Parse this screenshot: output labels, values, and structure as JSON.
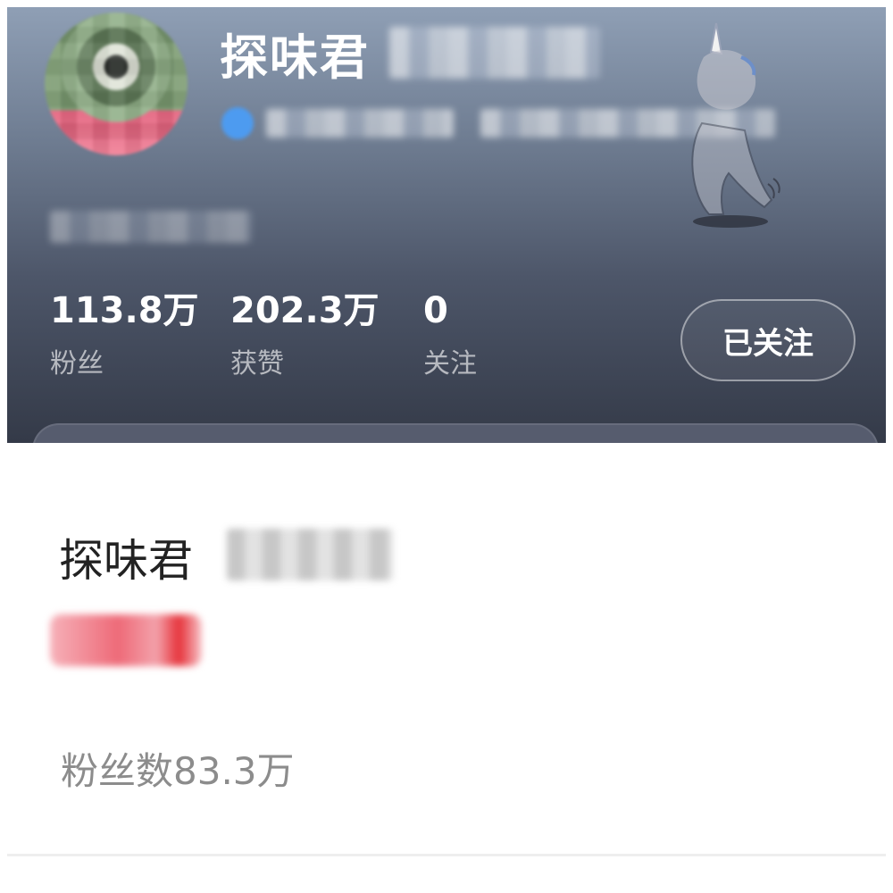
{
  "profile_header": {
    "name": "探味君",
    "stats": {
      "fans": {
        "value": "113.8万",
        "label": "粉丝"
      },
      "likes": {
        "value": "202.3万",
        "label": "获赞"
      },
      "following": {
        "value": "0",
        "label": "关注"
      }
    },
    "follow_button_label": "已关注",
    "icons": {
      "avatar": "avatar-image",
      "verification": "verified-badge-icon",
      "mascot": "unicorn-mascot-icon"
    },
    "colors": {
      "gradient_top": "#8f9fb5",
      "gradient_bottom": "#343a48",
      "verified_blue": "#4d9bf0"
    }
  },
  "account_card": {
    "name": "探味君",
    "fans_count": "粉丝数83.3万",
    "colors": {
      "tag_red": "#e6323a",
      "text_dark": "#222222",
      "text_gray": "#8c8c8c"
    }
  }
}
